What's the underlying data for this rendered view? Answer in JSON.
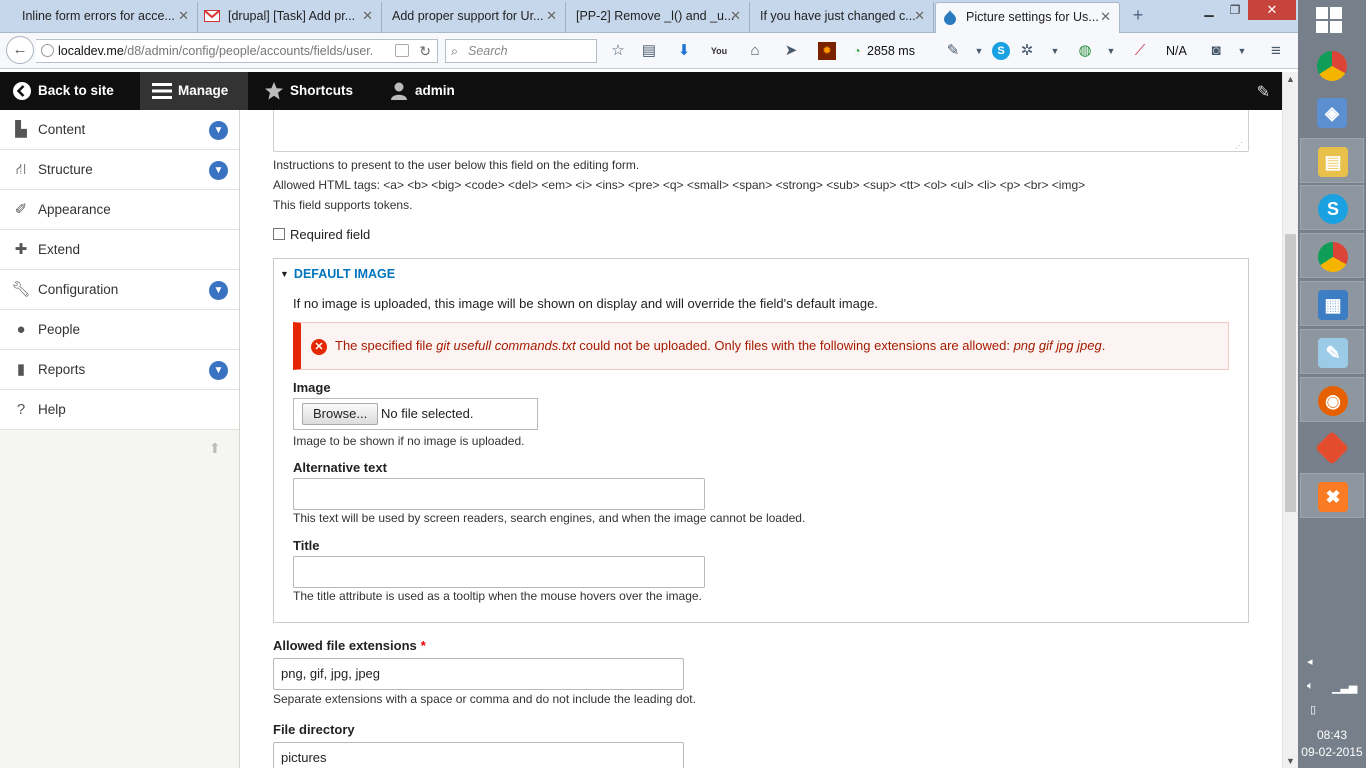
{
  "browser": {
    "tabs": [
      {
        "title": "Inline form errors for acce...",
        "active": false
      },
      {
        "title": "[drupal] [Task] Add pr...",
        "active": false,
        "favicon": "gmail-icon"
      },
      {
        "title": "Add proper support for Ur...",
        "active": false
      },
      {
        "title": "[PP-2] Remove _l() and _u...",
        "active": false
      },
      {
        "title": "If you have just changed c...",
        "active": false
      },
      {
        "title": "Picture settings for Us...",
        "active": true,
        "favicon": "drupal-icon"
      }
    ],
    "new_tab": "+",
    "url_host": "localdev.me",
    "url_path": "/d8/admin/config/people/accounts/fields/user.",
    "search_placeholder": "Search",
    "load_time": "2858 ms",
    "na_text": "N/A"
  },
  "toolbar": {
    "back_to_site": "Back to site",
    "manage": "Manage",
    "shortcuts": "Shortcuts",
    "user": "admin"
  },
  "sidebar": {
    "items": [
      {
        "label": "Content",
        "icon": "content-icon",
        "expandable": true
      },
      {
        "label": "Structure",
        "icon": "structure-icon",
        "expandable": true
      },
      {
        "label": "Appearance",
        "icon": "appearance-icon",
        "expandable": false
      },
      {
        "label": "Extend",
        "icon": "extend-icon",
        "expandable": false
      },
      {
        "label": "Configuration",
        "icon": "configuration-icon",
        "expandable": true
      },
      {
        "label": "People",
        "icon": "people-icon",
        "expandable": false
      },
      {
        "label": "Reports",
        "icon": "reports-icon",
        "expandable": true
      },
      {
        "label": "Help",
        "icon": "help-icon",
        "expandable": false
      }
    ]
  },
  "form": {
    "help_desc": "Instructions to present to the user below this field on the editing form.",
    "allowed_tags": "Allowed HTML tags: <a> <b> <big> <code> <del> <em> <i> <ins> <pre> <q> <small> <span> <strong> <sub> <sup> <tt> <ol> <ul> <li> <p> <br> <img>",
    "tokens": "This field supports tokens.",
    "required_label": "Required field",
    "default_image": {
      "summary": "DEFAULT IMAGE",
      "intro": "If no image is uploaded, this image will be shown on display and will override the field's default image.",
      "error_prefix": "The specified file ",
      "error_file": "git usefull commands.txt",
      "error_middle": " could not be uploaded. Only files with the following extensions are allowed: ",
      "error_exts": "png gif jpg jpeg",
      "error_suffix": ".",
      "image_label": "Image",
      "browse_label": "Browse...",
      "no_file": "No file selected.",
      "image_desc": "Image to be shown if no image is uploaded.",
      "alt_label": "Alternative text",
      "alt_value": "",
      "alt_desc": "This text will be used by screen readers, search engines, and when the image cannot be loaded.",
      "title_label": "Title",
      "title_value": "",
      "title_desc": "The title attribute is used as a tooltip when the mouse hovers over the image."
    },
    "extensions_label": "Allowed file extensions",
    "required_mark": "*",
    "extensions_value": "png, gif, jpg, jpeg",
    "extensions_desc": "Separate extensions with a space or comma and do not include the leading dot.",
    "directory_label": "File directory",
    "directory_value": "pictures"
  },
  "taskbar": {
    "apps": [
      "chrome-icon",
      "virtualbox-icon",
      "file-explorer-icon",
      "skype-icon",
      "chrome-user-icon",
      "control-panel-icon",
      "notepad-icon",
      "firefox-icon",
      "git-icon",
      "xampp-icon"
    ],
    "time": "08:43",
    "date": "09-02-2015"
  },
  "colors": {
    "toolbar_bg": "#0f0f0f",
    "link_blue": "#0074bd",
    "error_red": "#e62600",
    "error_text": "#a51b00",
    "toggle_blue": "#3b73c3"
  }
}
